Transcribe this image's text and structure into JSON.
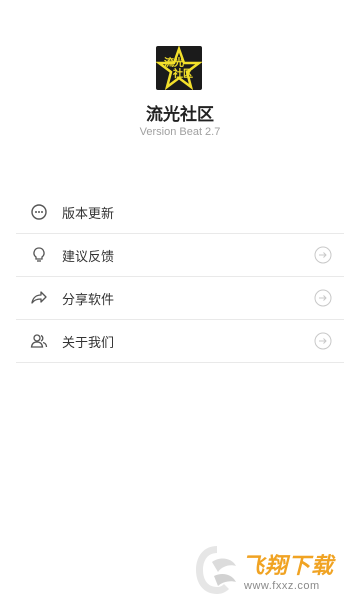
{
  "app": {
    "logo_line1": "流光",
    "logo_line2": "社区",
    "name": "流光社区",
    "version": "Version Beat 2.7"
  },
  "menu": {
    "items": [
      {
        "label": "版本更新",
        "icon": "chat-bubble-icon"
      },
      {
        "label": "建议反馈",
        "icon": "lightbulb-icon"
      },
      {
        "label": "分享软件",
        "icon": "share-arrow-icon"
      },
      {
        "label": "关于我们",
        "icon": "users-icon"
      }
    ]
  },
  "watermark": {
    "title": "飞翔下载",
    "url": "www.fxxz.com"
  },
  "colors": {
    "logo_bg": "#1b1b1b",
    "logo_accent": "#f3e02b",
    "divider": "#e9e9e9",
    "watermark_orange": "#f0a323"
  }
}
